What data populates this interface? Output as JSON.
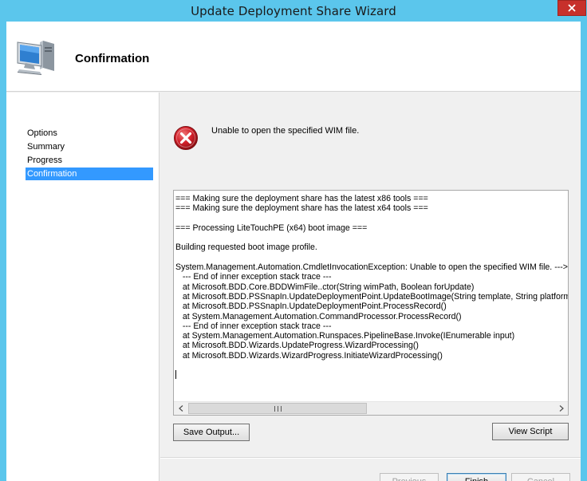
{
  "window": {
    "title": "Update Deployment Share Wizard",
    "close_icon": "close-icon"
  },
  "header": {
    "title": "Confirmation",
    "icon": "computer-icon"
  },
  "nav": {
    "items": [
      {
        "label": "Options",
        "selected": false
      },
      {
        "label": "Summary",
        "selected": false
      },
      {
        "label": "Progress",
        "selected": false
      },
      {
        "label": "Confirmation",
        "selected": true
      }
    ]
  },
  "status": {
    "icon": "error-icon",
    "message": "Unable to open the specified WIM file."
  },
  "log": {
    "text": "=== Making sure the deployment share has the latest x86 tools ===\n=== Making sure the deployment share has the latest x64 tools ===\n\n=== Processing LiteTouchPE (x64) boot image ===\n\nBuilding requested boot image profile.\n\nSystem.Management.Automation.CmdletInvocationException: Unable to open the specified WIM file. ---> System.Exception\n   --- End of inner exception stack trace ---\n   at Microsoft.BDD.Core.BDDWimFile..ctor(String wimPath, Boolean forUpdate)\n   at Microsoft.BDD.PSSnapIn.UpdateDeploymentPoint.UpdateBootImage(String template, String platform)\n   at Microsoft.BDD.PSSnapIn.UpdateDeploymentPoint.ProcessRecord()\n   at System.Management.Automation.CommandProcessor.ProcessRecord()\n   --- End of inner exception stack trace ---\n   at System.Management.Automation.Runspaces.PipelineBase.Invoke(IEnumerable input)\n   at Microsoft.BDD.Wizards.UpdateProgress.WizardProcessing()\n   at Microsoft.BDD.Wizards.WizardProgress.InitiateWizardProcessing()"
  },
  "buttons": {
    "save_output": "Save Output...",
    "view_script": "View Script",
    "previous": "Previous",
    "finish": "Finish",
    "cancel": "Cancel"
  },
  "colors": {
    "title_bar": "#5bc6ec",
    "selection": "#3399ff",
    "close_button": "#c7302b",
    "error_red": "#d3202a"
  }
}
